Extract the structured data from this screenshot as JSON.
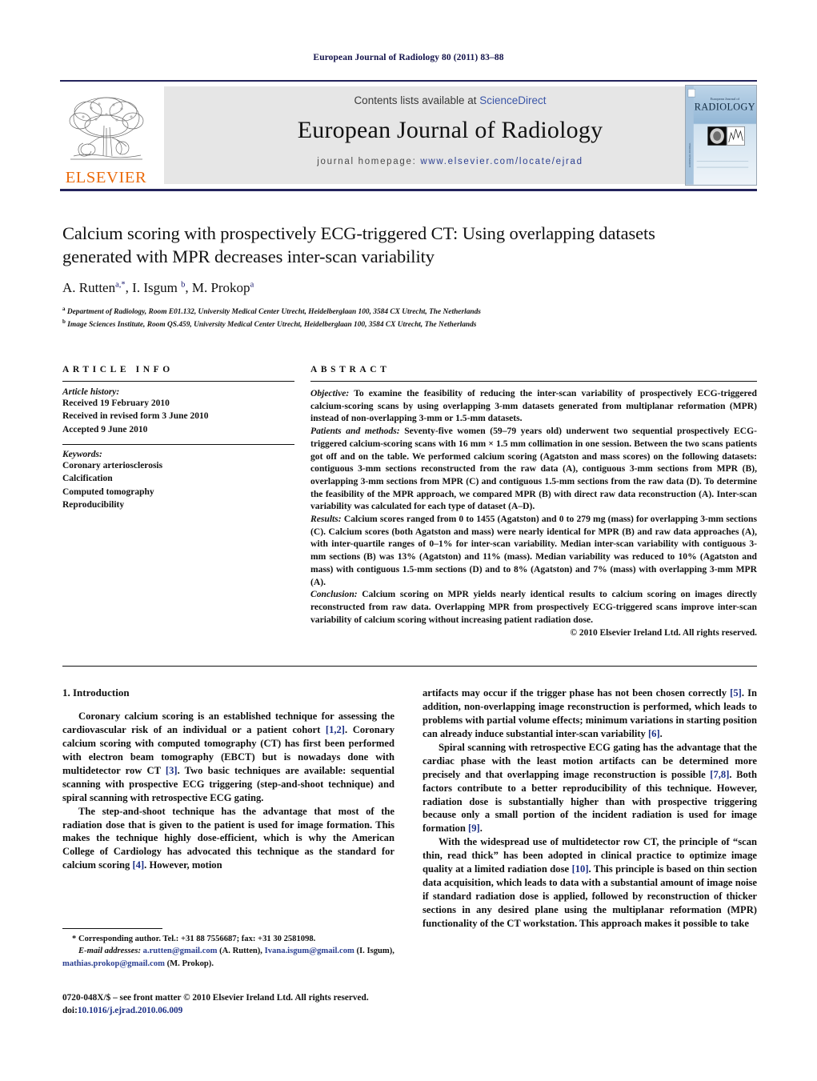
{
  "running_head": "European Journal of Radiology 80 (2011) 83–88",
  "masthead": {
    "contents_prefix": "Contents lists available at ",
    "sciencedirect": "ScienceDirect",
    "journal_title": "European Journal of Radiology",
    "homepage_label": "journal homepage: ",
    "homepage_url": "www.elsevier.com/locate/ejrad",
    "publisher_name": "ELSEVIER",
    "cover_line1": "European Journal of",
    "cover_line2": "RADIOLOGY",
    "accent_orange": "#eb6a0a",
    "accent_blue": "#2b3f91",
    "rule_color": "#23235c"
  },
  "article": {
    "title": "Calcium scoring with prospectively ECG-triggered CT: Using overlapping datasets generated with MPR decreases inter-scan variability",
    "authors_html": "A. Rutten<sup>a,</sup><sup>*</sup>, I. Isgum <sup>b</sup>, M. Prokop<sup>a</sup>",
    "affiliations": [
      "Department of Radiology, Room E01.132, University Medical Center Utrecht, Heidelberglaan 100, 3584 CX Utrecht, The Netherlands",
      "Image Sciences Institute, Room QS.459, University Medical Center Utrecht, Heidelberglaan 100, 3584 CX Utrecht, The Netherlands"
    ],
    "affiliation_marks": [
      "a",
      "b"
    ]
  },
  "article_info": {
    "heading": "ARTICLE INFO",
    "history_label": "Article history:",
    "history": [
      "Received 19 February 2010",
      "Received in revised form 3 June 2010",
      "Accepted 9 June 2010"
    ],
    "keywords_label": "Keywords:",
    "keywords": [
      "Coronary arteriosclerosis",
      "Calcification",
      "Computed tomography",
      "Reproducibility"
    ]
  },
  "abstract": {
    "heading": "ABSTRACT",
    "sections": [
      {
        "label": "Objective:",
        "text": " To examine the feasibility of reducing the inter-scan variability of prospectively ECG-triggered calcium-scoring scans by using overlapping 3-mm datasets generated from multiplanar reformation (MPR) instead of non-overlapping 3-mm or 1.5-mm datasets."
      },
      {
        "label": "Patients and methods:",
        "text": " Seventy-five women (59–79 years old) underwent two sequential prospectively ECG-triggered calcium-scoring scans with 16 mm × 1.5 mm collimation in one session. Between the two scans patients got off and on the table. We performed calcium scoring (Agatston and mass scores) on the following datasets: contiguous 3-mm sections reconstructed from the raw data (A), contiguous 3-mm sections from MPR (B), overlapping 3-mm sections from MPR (C) and contiguous 1.5-mm sections from the raw data (D). To determine the feasibility of the MPR approach, we compared MPR (B) with direct raw data reconstruction (A). Inter-scan variability was calculated for each type of dataset (A–D)."
      },
      {
        "label": "Results:",
        "text": " Calcium scores ranged from 0 to 1455 (Agatston) and 0 to 279 mg (mass) for overlapping 3-mm sections (C). Calcium scores (both Agatston and mass) were nearly identical for MPR (B) and raw data approaches (A), with inter-quartile ranges of 0–1% for inter-scan variability. Median inter-scan variability with contiguous 3-mm sections (B) was 13% (Agatston) and 11% (mass). Median variability was reduced to 10% (Agatston and mass) with contiguous 1.5-mm sections (D) and to 8% (Agatston) and 7% (mass) with overlapping 3-mm MPR (A)."
      },
      {
        "label": "Conclusion:",
        "text": " Calcium scoring on MPR yields nearly identical results to calcium scoring on images directly reconstructed from raw data. Overlapping MPR from prospectively ECG-triggered scans improve inter-scan variability of calcium scoring without increasing patient radiation dose."
      }
    ],
    "copyright": "© 2010 Elsevier Ireland Ltd. All rights reserved."
  },
  "body": {
    "section_heading": "1. Introduction",
    "left_paragraphs": [
      {
        "parts": [
          {
            "t": "Coronary calcium scoring is an established technique for assessing the cardiovascular risk of an individual or a patient cohort "
          },
          {
            "t": "[1,2]",
            "ref": true
          },
          {
            "t": ". Coronary calcium scoring with computed tomography (CT) has first been performed with electron beam tomography (EBCT) but is nowadays done with multidetector row CT "
          },
          {
            "t": "[3]",
            "ref": true
          },
          {
            "t": ". Two basic techniques are available: sequential scanning with prospective ECG triggering (step-and-shoot technique) and spiral scanning with retrospective ECG gating."
          }
        ]
      },
      {
        "parts": [
          {
            "t": "The step-and-shoot technique has the advantage that most of the radiation dose that is given to the patient is used for image formation. This makes the technique highly dose-efficient, which is why the American College of Cardiology has advocated this technique as the standard for calcium scoring "
          },
          {
            "t": "[4]",
            "ref": true
          },
          {
            "t": ". However, motion"
          }
        ]
      }
    ],
    "right_paragraphs": [
      {
        "parts": [
          {
            "t": "artifacts may occur if the trigger phase has not been chosen correctly "
          },
          {
            "t": "[5]",
            "ref": true
          },
          {
            "t": ". In addition, non-overlapping image reconstruction is performed, which leads to problems with partial volume effects; minimum variations in starting position can already induce substantial inter-scan variability "
          },
          {
            "t": "[6]",
            "ref": true
          },
          {
            "t": "."
          }
        ],
        "no_indent": true
      },
      {
        "parts": [
          {
            "t": "Spiral scanning with retrospective ECG gating has the advantage that the cardiac phase with the least motion artifacts can be determined more precisely and that overlapping image reconstruction is possible "
          },
          {
            "t": "[7,8]",
            "ref": true
          },
          {
            "t": ". Both factors contribute to a better reproducibility of this technique. However, radiation dose is substantially higher than with prospective triggering because only a small portion of the incident radiation is used for image formation "
          },
          {
            "t": "[9]",
            "ref": true
          },
          {
            "t": "."
          }
        ]
      },
      {
        "parts": [
          {
            "t": "With the widespread use of multidetector row CT, the principle of “scan thin, read thick” has been adopted in clinical practice to optimize image quality at a limited radiation dose "
          },
          {
            "t": "[10]",
            "ref": true
          },
          {
            "t": ". This principle is based on thin section data acquisition, which leads to data with a substantial amount of image noise if standard radiation dose is applied, followed by reconstruction of thicker sections in any desired plane using the multiplanar reformation (MPR) functionality of the CT workstation. This approach makes it possible to take"
          }
        ]
      }
    ]
  },
  "footnotes": {
    "corresponding": "* Corresponding author. Tel.: +31 88 7556687; fax: +31 30 2581098.",
    "email_label": "E-mail addresses:",
    "emails": [
      {
        "address": "a.rutten@gmail.com",
        "owner": " (A. Rutten), "
      },
      {
        "address": "Ivana.isgum@gmail.com",
        "owner": " (I. Isgum), "
      },
      {
        "address": "mathias.prokop@gmail.com",
        "owner": " (M. Prokop)."
      }
    ]
  },
  "imprint": {
    "line1": "0720-048X/$ – see front matter © 2010 Elsevier Ireland Ltd. All rights reserved.",
    "doi_prefix": "doi:",
    "doi": "10.1016/j.ejrad.2010.06.009"
  }
}
